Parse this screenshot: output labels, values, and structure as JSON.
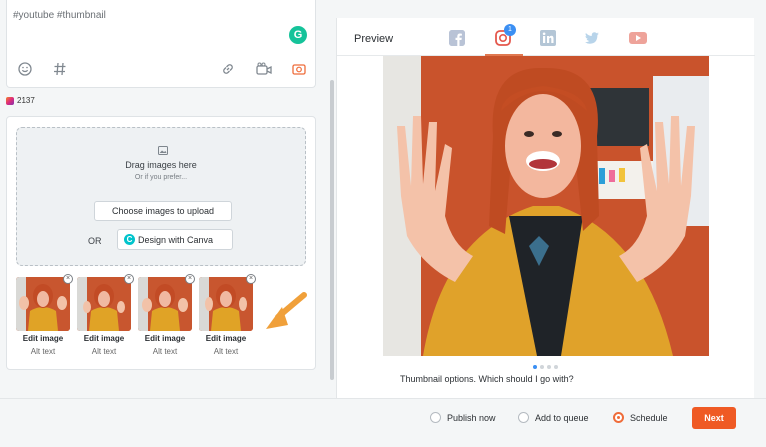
{
  "composer": {
    "text": "#youtube #thumbnail",
    "grammarly_icon": "G",
    "char_count": "2137"
  },
  "media": {
    "drag_title": "Drag images here",
    "drag_sub": "Or if you prefer...",
    "upload_label": "Choose images to upload",
    "or_label": "OR",
    "canva_label": "Design with Canva",
    "canva_icon": "C",
    "thumbnails": [
      {
        "edit": "Edit image",
        "alt": "Alt text"
      },
      {
        "edit": "Edit image",
        "alt": "Alt text"
      },
      {
        "edit": "Edit image",
        "alt": "Alt text"
      },
      {
        "edit": "Edit image",
        "alt": "Alt text"
      }
    ]
  },
  "preview": {
    "label": "Preview",
    "ig_badge": "1",
    "caption": "Thumbnail options. Which should I go with?"
  },
  "footer": {
    "publish_now": "Publish now",
    "add_to_queue": "Add to queue",
    "schedule": "Schedule",
    "next": "Next",
    "selected": "schedule"
  },
  "colors": {
    "accent": "#ef5a24",
    "active_radio": "#ef6c3a",
    "badge": "#3b8ff3"
  }
}
